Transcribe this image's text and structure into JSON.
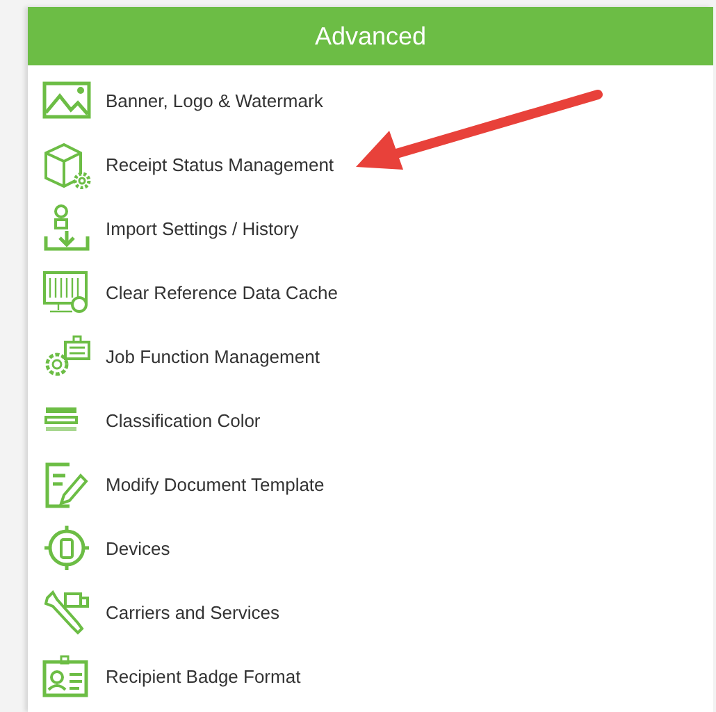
{
  "panel": {
    "title": "Advanced",
    "items": [
      {
        "label": "Banner, Logo & Watermark"
      },
      {
        "label": "Receipt Status Management"
      },
      {
        "label": "Import Settings / History"
      },
      {
        "label": "Clear Reference Data Cache"
      },
      {
        "label": "Job Function Management"
      },
      {
        "label": "Classification Color"
      },
      {
        "label": "Modify Document Template"
      },
      {
        "label": "Devices"
      },
      {
        "label": "Carriers and Services"
      },
      {
        "label": "Recipient Badge Format"
      }
    ]
  }
}
